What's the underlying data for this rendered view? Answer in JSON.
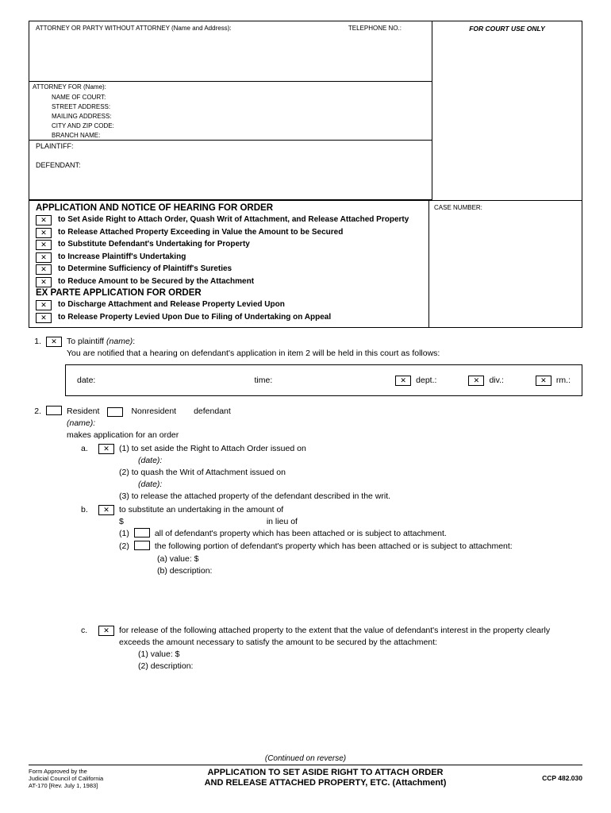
{
  "header": {
    "attorney_label": "ATTORNEY OR PARTY WITHOUT ATTORNEY (Name and Address):",
    "telephone_label": "TELEPHONE NO.:",
    "court_use": "FOR COURT USE ONLY",
    "attorney_for": "ATTORNEY FOR (Name):"
  },
  "court": {
    "name": "NAME OF COURT:",
    "street": "STREET ADDRESS:",
    "mailing": "MAILING ADDRESS:",
    "city": "CITY AND ZIP CODE:",
    "branch": "BRANCH NAME:"
  },
  "parties": {
    "plaintiff": "PLAINTIFF:",
    "defendant": "DEFENDANT:"
  },
  "case_label": "CASE NUMBER:",
  "app": {
    "title1": "APPLICATION AND NOTICE OF HEARING FOR ORDER",
    "opts1": [
      "to Set Aside Right to Attach Order, Quash Writ of Attachment, and Release Attached Property",
      "to Release Attached Property Exceeding in Value the Amount to be Secured",
      "to Substitute Defendant's Undertaking for Property",
      "to Increase Plaintiff's Undertaking",
      "to Determine Sufficiency of Plaintiff's Sureties",
      "to Reduce Amount to be Secured by the Attachment"
    ],
    "title2": "EX PARTE APPLICATION FOR ORDER",
    "opts2": [
      "to Discharge Attachment and Release Property Levied Upon",
      "to Release Property Levied Upon Due to Filing of Undertaking on Appeal"
    ]
  },
  "item1": {
    "to_plaintiff": "To plaintiff (name):",
    "notice": "You are notified that a hearing on defendant's application in item 2 will be held in this court as follows:",
    "date": "date:",
    "time": "time:",
    "dept": "dept.:",
    "div": "div.:",
    "rm": "rm.:"
  },
  "item2": {
    "resident": "Resident",
    "nonresident": "Nonresident",
    "defendant": "defendant",
    "name": "(name):",
    "makes": "makes application for an order",
    "a": {
      "l1": "(1)  to set aside the Right to Attach Order issued on",
      "d1": "(date):",
      "l2": "(2)  to quash the Writ of Attachment issued on",
      "d2": "(date):",
      "l3": "(3)  to release the attached property of the defendant described in the writ."
    },
    "b": {
      "head": "to substitute an undertaking in the amount of",
      "dollar": "$",
      "lieu": "in lieu of",
      "opt1": "all of defendant's property which has been attached or is subject to attachment.",
      "opt2": "the following portion of defendant's property which has been attached or is subject to attachment:",
      "va": "(a) value: $",
      "vb": "(b) description:"
    },
    "c": {
      "head": "for release of the following attached property to the extent that the value of defendant's interest in the property clearly exceeds the amount necessary to satisfy the amount to be secured by the attachment:",
      "v1": "(1) value: $",
      "v2": "(2) description:"
    }
  },
  "footer": {
    "continued": "(Continued on reverse)",
    "approved": "Form Approved by the",
    "council": "Judicial Council of California",
    "rev": "AT-170 [Rev. July 1, 1983]",
    "title1": "APPLICATION TO SET ASIDE RIGHT TO ATTACH ORDER",
    "title2": "AND RELEASE ATTACHED PROPERTY, ETC. (Attachment)",
    "ccp": "CCP 482.030"
  }
}
